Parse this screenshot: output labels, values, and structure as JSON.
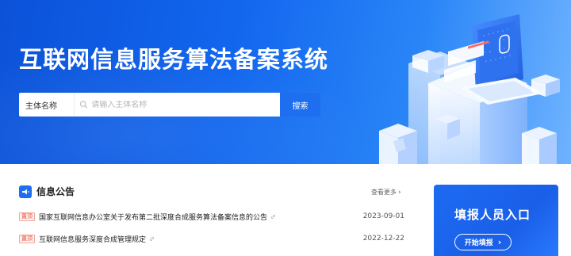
{
  "hero": {
    "title": "互联网信息服务算法备案系统"
  },
  "search": {
    "type_label": "主体名称",
    "placeholder": "请输入主体名称",
    "button_label": "搜索"
  },
  "notices": {
    "section_title": "信息公告",
    "more_label": "查看更多",
    "items": [
      {
        "tag": "置顶",
        "text": "国家互联网信息办公室关于发布第二批深度合成服务算法备案信息的公告",
        "date": "2023-09-01"
      },
      {
        "tag": "置顶",
        "text": "互联网信息服务深度合成管理规定",
        "date": "2022-12-22"
      }
    ]
  },
  "entry": {
    "title": "填报人员入口",
    "button_label": "开始填报"
  },
  "colors": {
    "brand_blue": "#1e6ff0",
    "tag_red": "#e04a3a"
  }
}
